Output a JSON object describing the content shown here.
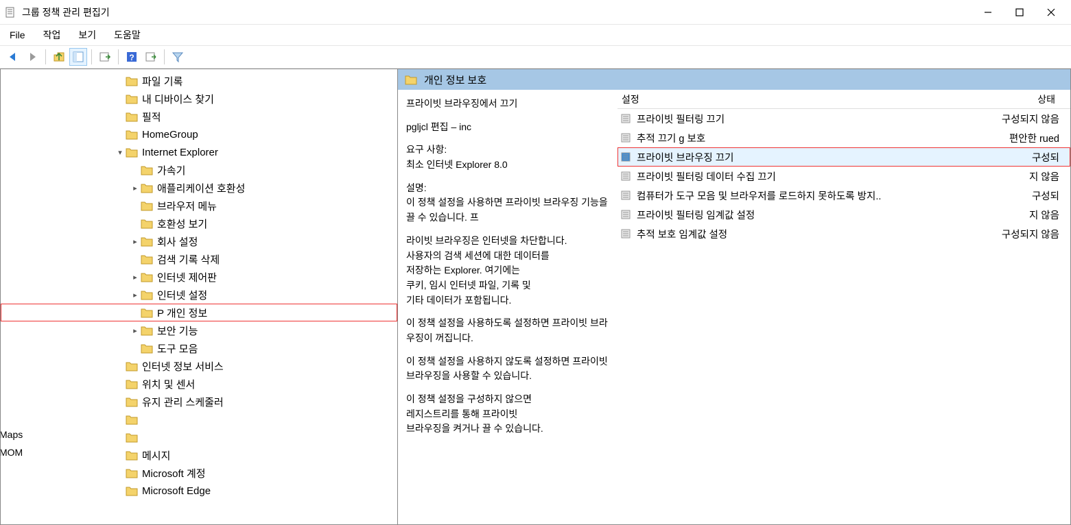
{
  "window": {
    "title": "그룹 정책 관리 편집기"
  },
  "menu": {
    "file": "File",
    "action": "작업",
    "view": "보기",
    "help": "도움말"
  },
  "tree": {
    "items": [
      {
        "indent": 3,
        "exp": "",
        "label": "파일 기록"
      },
      {
        "indent": 3,
        "exp": "",
        "label": "내 디바이스 찾기"
      },
      {
        "indent": 3,
        "exp": "",
        "label": "필적"
      },
      {
        "indent": 3,
        "exp": "",
        "label": "HomeGroup"
      },
      {
        "indent": 3,
        "exp": "v",
        "label": "Internet Explorer"
      },
      {
        "indent": 4,
        "exp": "",
        "label": "가속기"
      },
      {
        "indent": 4,
        "exp": ">",
        "label": "애플리케이션 호환성"
      },
      {
        "indent": 4,
        "exp": "",
        "label": "브라우저 메뉴"
      },
      {
        "indent": 4,
        "exp": "",
        "label": "호환성 보기"
      },
      {
        "indent": 4,
        "exp": ">",
        "label": "회사 설정"
      },
      {
        "indent": 4,
        "exp": "",
        "label": "검색 기록 삭제"
      },
      {
        "indent": 4,
        "exp": ">",
        "label": "인터넷 제어판"
      },
      {
        "indent": 4,
        "exp": ">",
        "label": "인터넷 설정"
      },
      {
        "indent": 4,
        "exp": "",
        "label": "P 개인 정보",
        "selected": true
      },
      {
        "indent": 4,
        "exp": ">",
        "label": "보안 기능"
      },
      {
        "indent": 4,
        "exp": "",
        "label": "도구 모음"
      },
      {
        "indent": 3,
        "exp": "",
        "label": "인터넷 정보 서비스"
      },
      {
        "indent": 3,
        "exp": "",
        "label": "위치 및 센서"
      },
      {
        "indent": 3,
        "exp": "",
        "label": "유지 관리 스케줄러"
      },
      {
        "indent": 3,
        "exp": "",
        "label": ""
      },
      {
        "indent": 3,
        "exp": "",
        "label": ""
      },
      {
        "indent": 3,
        "exp": "",
        "label": "메시지"
      },
      {
        "indent": 3,
        "exp": "",
        "label": "Microsoft 계정"
      },
      {
        "indent": 3,
        "exp": "",
        "label": "Microsoft Edge"
      }
    ],
    "cut_left": [
      "Maps",
      "MOM"
    ]
  },
  "right": {
    "header": "개인 정보 보호",
    "detail": {
      "title": "프라이빗 브라우징에서 끄기",
      "edit_line": "pgljcl 편집 – inc",
      "req_label": "요구 사항:",
      "req_value": "최소 인터넷 Explorer 8.0",
      "desc_label": "설명:",
      "desc_1": "이 정책 설정을 사용하면 프라이빗 브라우징 기능을 끌 수 있습니다. 프",
      "desc_2": "라이빗 브라우징은 인터넷을 차단합니다.\n사용자의 검색 세션에 대한 데이터를\n저장하는 Explorer. 여기에는\n쿠키, 임시 인터넷 파일, 기록 및\n기타 데이터가 포함됩니다.",
      "desc_3": "이 정책 설정을 사용하도록 설정하면 프라이빗 브라우징이 꺼집니다.",
      "desc_4": "이 정책 설정을 사용하지 않도록 설정하면 프라이빗 브라우징을 사용할 수 있습니다.",
      "desc_5": "이 정책 설정을 구성하지 않으면\n레지스트리를 통해 프라이빗\n브라우징을 켜거나 끌 수 있습니다."
    },
    "list": {
      "col_setting": "설정",
      "col_state": "상태",
      "rows": [
        {
          "name": "프라이빗 필터링 끄기",
          "state": "구성되지 않음"
        },
        {
          "name": "추적 끄기          g 보호",
          "state": "편안한 rued"
        },
        {
          "name": "프라이빗 브라우징 끄기",
          "state": "구성되",
          "selected": true
        },
        {
          "name": "프라이빗 필터링 데이터 수집 끄기",
          "state": "지 않음"
        },
        {
          "name": "컴퓨터가 도구 모음 및 브라우저를 로드하지 못하도록 방지..",
          "state": "구성되"
        },
        {
          "name": "프라이빗 필터링 임계값 설정",
          "state": "지 않음"
        },
        {
          "name": "추적 보호 임계값 설정",
          "state": "구성되지 않음"
        }
      ]
    }
  }
}
